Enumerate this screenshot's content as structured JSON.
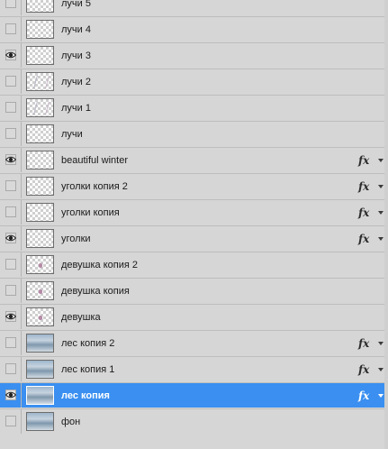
{
  "layers": [
    {
      "name": "лучи 5",
      "visible": false,
      "fx": false,
      "thumb": "checker"
    },
    {
      "name": "лучи 4",
      "visible": false,
      "fx": false,
      "thumb": "checker"
    },
    {
      "name": "лучи 3",
      "visible": true,
      "fx": false,
      "thumb": "checker"
    },
    {
      "name": "лучи 2",
      "visible": false,
      "fx": false,
      "thumb": "rays"
    },
    {
      "name": "лучи 1",
      "visible": false,
      "fx": false,
      "thumb": "rays"
    },
    {
      "name": "лучи",
      "visible": false,
      "fx": false,
      "thumb": "checker"
    },
    {
      "name": "beautiful winter",
      "visible": true,
      "fx": true,
      "thumb": "checker"
    },
    {
      "name": "уголки копия 2",
      "visible": false,
      "fx": true,
      "thumb": "checker"
    },
    {
      "name": "уголки копия",
      "visible": false,
      "fx": true,
      "thumb": "checker"
    },
    {
      "name": "уголки",
      "visible": true,
      "fx": true,
      "thumb": "checker"
    },
    {
      "name": "девушка копия 2",
      "visible": false,
      "fx": false,
      "thumb": "girl"
    },
    {
      "name": "девушка копия",
      "visible": false,
      "fx": false,
      "thumb": "girl"
    },
    {
      "name": "девушка",
      "visible": true,
      "fx": false,
      "thumb": "girl"
    },
    {
      "name": "лес копия 2",
      "visible": false,
      "fx": true,
      "thumb": "photo"
    },
    {
      "name": "лес копия 1",
      "visible": false,
      "fx": true,
      "thumb": "photo"
    },
    {
      "name": "лес копия",
      "visible": true,
      "fx": true,
      "thumb": "photo",
      "selected": true
    },
    {
      "name": "фон",
      "visible": false,
      "fx": false,
      "thumb": "photo"
    }
  ],
  "fx_label": "fx",
  "icons": {
    "visibility": "eye-icon",
    "effects": "fx-icon",
    "expand": "triangle-down-icon"
  },
  "colors": {
    "selected_row": "#3a8ff0",
    "panel": "#d6d6d6"
  }
}
